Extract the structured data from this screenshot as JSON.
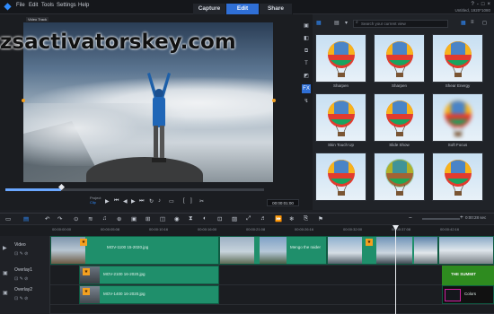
{
  "app": {
    "menu": [
      "File",
      "Edit",
      "Tools",
      "Settings",
      "Help"
    ],
    "tabs": [
      "Capture",
      "Edit",
      "Share"
    ],
    "active_tab": "Edit",
    "project_info": "Untitled, 1920*1080",
    "window_controls": [
      "?",
      "-",
      "□",
      "×"
    ]
  },
  "preview": {
    "frame_label": "Video Track",
    "watermark": "zsactivatorskey.com",
    "mode_label_1": "Project",
    "mode_label_2": "Clip",
    "timecode": "00:00:01:00",
    "playback_controls": [
      "play-icon",
      "home-icon",
      "prev-frame-icon",
      "next-frame-icon",
      "end-icon",
      "repeat-icon",
      "volume-icon"
    ]
  },
  "library": {
    "search_placeholder": "Search your current view",
    "thumbs": [
      {
        "caption": "Sharpen"
      },
      {
        "caption": "Sharpen"
      },
      {
        "caption": "Shear Energy"
      },
      {
        "caption": "Skin Touch Up"
      },
      {
        "caption": "Slide Show"
      },
      {
        "caption": "Soft Focus"
      },
      {
        "caption": ""
      },
      {
        "caption": ""
      },
      {
        "caption": ""
      }
    ],
    "side_tools": [
      "media-icon",
      "instant-project-icon",
      "transition-icon",
      "title-icon",
      "graphic-icon",
      "fx-icon",
      "path-icon"
    ],
    "fx_label": "FX"
  },
  "timeline": {
    "zoom_time": "0:00:28 sec",
    "ruler": [
      "00:00:00:00",
      "00:00:05:08",
      "00:00:10:16",
      "00:00:16:00",
      "00:00:21:08",
      "00:00:26:16",
      "00:00:32:00",
      "00:00:37:08",
      "00:00:42:16"
    ],
    "tracks": [
      {
        "name": "Video"
      },
      {
        "name": "Overlay1"
      },
      {
        "name": "Overlay2"
      }
    ],
    "video_clips": [
      {
        "name": "MOV-1100 15-2020.jpg"
      },
      {
        "name": "Mengo the raider"
      },
      {
        "name": ""
      }
    ],
    "overlay1_clip": "MOV-2100 16-2020.jpg",
    "overlay2_clip": "MOV-1400 16-2020.jpg",
    "title_clip": "THE SUMMIT",
    "colors_clip": "Colors"
  },
  "colors": {
    "accent": "#2f6fd6",
    "clip": "#1f8f6b",
    "title_clip": "#2e8b1f",
    "marker": "#f4a020"
  }
}
